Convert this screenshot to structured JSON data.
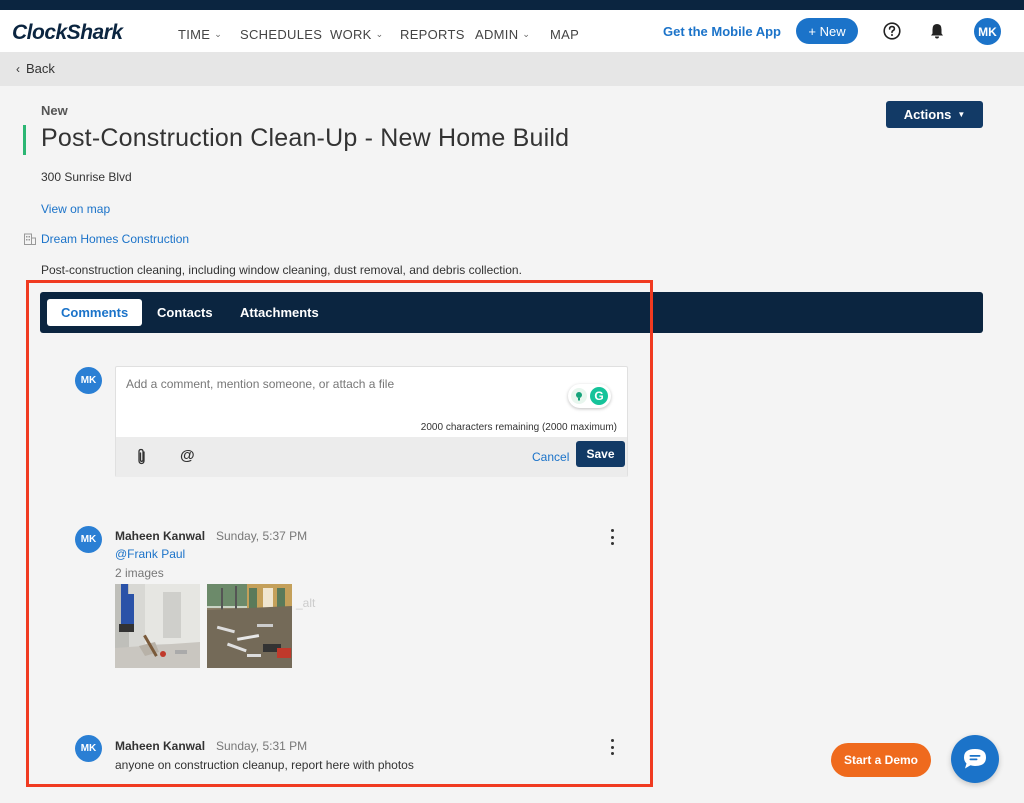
{
  "app": {
    "logo": "ClockShark",
    "nav": [
      {
        "label": "TIME",
        "dropdown": true
      },
      {
        "label": "SCHEDULES",
        "dropdown": false
      },
      {
        "label": "WORK",
        "dropdown": true
      },
      {
        "label": "REPORTS",
        "dropdown": false
      },
      {
        "label": "ADMIN",
        "dropdown": true
      },
      {
        "label": "MAP",
        "dropdown": false
      }
    ],
    "mobile_link": "Get the Mobile App",
    "new_button": "+ New",
    "user_initials": "MK"
  },
  "back": {
    "label": "Back"
  },
  "job": {
    "status": "New",
    "title": "Post-Construction Clean-Up - New Home Build",
    "actions_label": "Actions",
    "address": "300 Sunrise Blvd",
    "map_link": "View on map",
    "company": "Dream Homes Construction",
    "description": "Post-construction cleaning, including window cleaning, dust removal, and debris collection."
  },
  "tabs": [
    {
      "label": "Comments",
      "active": true
    },
    {
      "label": "Contacts",
      "active": false
    },
    {
      "label": "Attachments",
      "active": false
    }
  ],
  "composer": {
    "avatar": "MK",
    "placeholder": "Add a comment, mention someone, or attach a file",
    "char_count": "2000 characters remaining (2000 maximum)",
    "attach_icon": "paperclip-icon",
    "mention_icon": "@",
    "cancel_label": "Cancel",
    "save_label": "Save"
  },
  "comments": [
    {
      "avatar": "MK",
      "author": "Maheen Kanwal",
      "time": "Sunday, 5:37 PM",
      "mention": "@Frank Paul",
      "images_label": "2 images",
      "alt_text": "_alt"
    },
    {
      "avatar": "MK",
      "author": "Maheen Kanwal",
      "time": "Sunday, 5:31 PM",
      "body": "anyone on construction cleanup, report here with photos"
    }
  ],
  "demo_button": "Start a Demo",
  "colors": {
    "navy": "#0b2540",
    "brand_blue": "#1b73c9",
    "accent_green": "#2bb673",
    "highlight_red": "#f03a20",
    "demo_orange": "#ef6a1d"
  }
}
